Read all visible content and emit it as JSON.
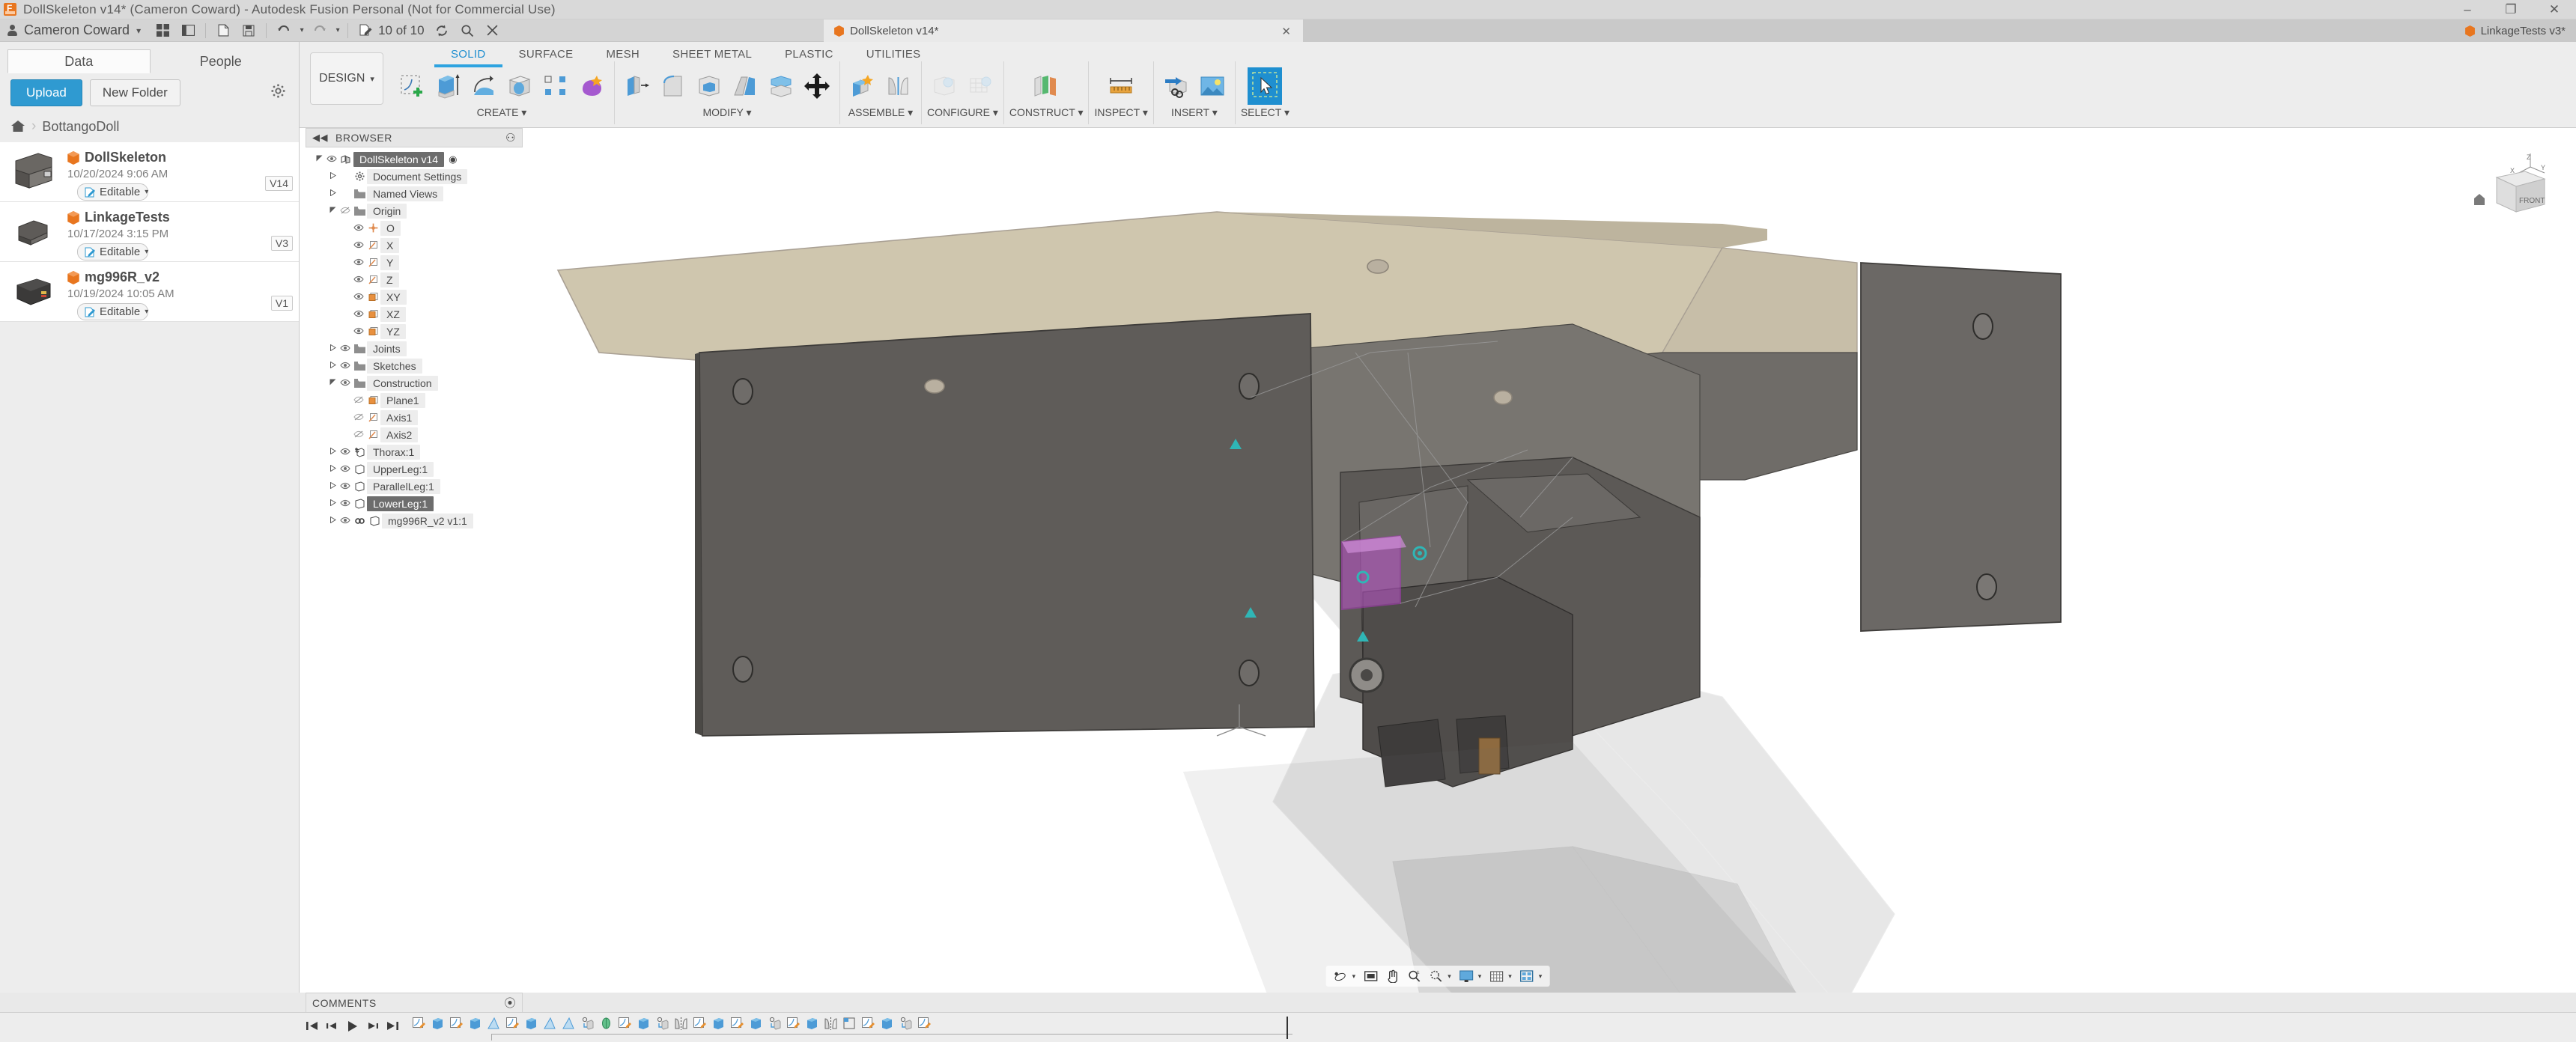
{
  "window": {
    "title": "DollSkeleton v14* (Cameron Coward) - Autodesk Fusion Personal (Not for Commercial Use)",
    "minimize": "–",
    "maximize": "❐",
    "close": "✕",
    "app_icon": "fusion-logo-icon"
  },
  "account": {
    "name": "Cameron Coward",
    "caret": "▾",
    "job_count": "10 of 10",
    "icons": [
      "jobs-icon",
      "refresh-icon",
      "search-icon",
      "close-icon"
    ]
  },
  "quick_access": {
    "icons": [
      "grid-icon",
      "panel-icon",
      "file-icon",
      "save-icon",
      "undo-icon",
      "redo-icon"
    ]
  },
  "doc_tabs": [
    {
      "label": "DollSkeleton v14*",
      "active": true,
      "close": "✕"
    },
    {
      "label": "LinkageTests v3*",
      "active": false,
      "close": ""
    }
  ],
  "data_panel": {
    "tabs": [
      {
        "label": "Data",
        "selected": true
      },
      {
        "label": "People",
        "selected": false
      }
    ],
    "upload_label": "Upload",
    "new_folder_label": "New Folder",
    "settings_icon": "gear-icon",
    "breadcrumb": {
      "home_icon": "home-icon",
      "chevron": "›",
      "text": "BottangoDoll"
    },
    "files": [
      {
        "name": "DollSkeleton",
        "date": "10/20/2024 9:06 AM",
        "permission": "Editable",
        "permission_icon": "editable-pen-icon",
        "version": "V14",
        "thumb": "bracket-thumb"
      },
      {
        "name": "LinkageTests",
        "date": "10/17/2024 3:15 PM",
        "permission": "Editable",
        "permission_icon": "editable-pen-icon",
        "version": "V3",
        "thumb": "linkage-thumb"
      },
      {
        "name": "mg996R_v2",
        "date": "10/19/2024 10:05 AM",
        "permission": "Editable",
        "permission_icon": "editable-pen-icon",
        "version": "V1",
        "thumb": "servo-thumb"
      }
    ]
  },
  "ribbon": {
    "workspace": "DESIGN",
    "workspace_caret": "▾",
    "tabs": [
      {
        "label": "SOLID",
        "selected": true
      },
      {
        "label": "SURFACE",
        "selected": false
      },
      {
        "label": "MESH",
        "selected": false
      },
      {
        "label": "SHEET METAL",
        "selected": false
      },
      {
        "label": "PLASTIC",
        "selected": false
      },
      {
        "label": "UTILITIES",
        "selected": false
      }
    ],
    "panels": [
      {
        "label": "CREATE",
        "caret": "▾",
        "buttons": [
          "new-sketch-icon",
          "extrude-icon",
          "revolve-icon",
          "hole-icon",
          "pattern-icon",
          "form-icon"
        ]
      },
      {
        "label": "MODIFY",
        "caret": "▾",
        "buttons": [
          "press-pull-icon",
          "fillet-icon",
          "shell-icon",
          "draft-icon",
          "split-body-icon",
          "move-copy-icon"
        ]
      },
      {
        "label": "ASSEMBLE",
        "caret": "▾",
        "buttons": [
          "new-component-icon",
          "joint-icon"
        ]
      },
      {
        "label": "CONFIGURE",
        "caret": "▾",
        "buttons": [
          "configure-icon",
          "configure-table-icon"
        ]
      },
      {
        "label": "CONSTRUCT",
        "caret": "▾",
        "buttons": [
          "offset-plane-icon"
        ]
      },
      {
        "label": "INSPECT",
        "caret": "▾",
        "buttons": [
          "measure-icon"
        ]
      },
      {
        "label": "INSERT",
        "caret": "▾",
        "buttons": [
          "insert-derive-icon",
          "decal-icon"
        ]
      },
      {
        "label": "SELECT",
        "caret": "▾",
        "buttons": [
          "select-cursor-icon"
        ]
      }
    ]
  },
  "browser": {
    "title": "BROWSER",
    "collapse_icon": "double-chevron-left-icon",
    "options_icon": "circle-minus-icon",
    "nodes": [
      {
        "label": "DollSkeleton v14",
        "depth": 0,
        "expander": "expanded",
        "eye": "visible",
        "icon": "assembly-icon",
        "selected": true,
        "trailing": "radio-icon"
      },
      {
        "label": "Document Settings",
        "depth": 1,
        "expander": "collapsed",
        "eye": "",
        "icon": "gear-icon",
        "selected": false
      },
      {
        "label": "Named Views",
        "depth": 1,
        "expander": "collapsed",
        "eye": "",
        "icon": "folder-icon",
        "selected": false
      },
      {
        "label": "Origin",
        "depth": 1,
        "expander": "expanded",
        "eye": "hidden",
        "icon": "folder-icon",
        "selected": false
      },
      {
        "label": "O",
        "depth": 2,
        "expander": "",
        "eye": "visible",
        "icon": "origin-point-icon",
        "selected": false
      },
      {
        "label": "X",
        "depth": 2,
        "expander": "",
        "eye": "visible",
        "icon": "axis-icon",
        "selected": false
      },
      {
        "label": "Y",
        "depth": 2,
        "expander": "",
        "eye": "visible",
        "icon": "axis-icon",
        "selected": false
      },
      {
        "label": "Z",
        "depth": 2,
        "expander": "",
        "eye": "visible",
        "icon": "axis-icon",
        "selected": false
      },
      {
        "label": "XY",
        "depth": 2,
        "expander": "",
        "eye": "visible",
        "icon": "plane-icon",
        "selected": false
      },
      {
        "label": "XZ",
        "depth": 2,
        "expander": "",
        "eye": "visible",
        "icon": "plane-icon",
        "selected": false
      },
      {
        "label": "YZ",
        "depth": 2,
        "expander": "",
        "eye": "visible",
        "icon": "plane-icon",
        "selected": false
      },
      {
        "label": "Joints",
        "depth": 1,
        "expander": "collapsed",
        "eye": "visible",
        "icon": "folder-icon",
        "selected": false
      },
      {
        "label": "Sketches",
        "depth": 1,
        "expander": "collapsed",
        "eye": "visible",
        "icon": "folder-icon",
        "selected": false
      },
      {
        "label": "Construction",
        "depth": 1,
        "expander": "expanded",
        "eye": "visible",
        "icon": "folder-icon",
        "selected": false
      },
      {
        "label": "Plane1",
        "depth": 2,
        "expander": "",
        "eye": "hidden",
        "icon": "plane-icon",
        "selected": false
      },
      {
        "label": "Axis1",
        "depth": 2,
        "expander": "",
        "eye": "hidden",
        "icon": "axis-icon",
        "selected": false
      },
      {
        "label": "Axis2",
        "depth": 2,
        "expander": "",
        "eye": "hidden",
        "icon": "axis-icon",
        "selected": false
      },
      {
        "label": "Thorax:1",
        "depth": 1,
        "expander": "collapsed",
        "eye": "visible",
        "icon": "grounded-component-icon",
        "selected": false
      },
      {
        "label": "UpperLeg:1",
        "depth": 1,
        "expander": "collapsed",
        "eye": "visible",
        "icon": "component-icon",
        "selected": false
      },
      {
        "label": "ParallelLeg:1",
        "depth": 1,
        "expander": "collapsed",
        "eye": "visible",
        "icon": "component-icon",
        "selected": false
      },
      {
        "label": "LowerLeg:1",
        "depth": 1,
        "expander": "collapsed",
        "eye": "visible",
        "icon": "component-icon",
        "selected": true
      },
      {
        "label": "mg996R_v2 v1:1",
        "depth": 1,
        "expander": "collapsed",
        "eye": "visible",
        "icon": "component-icon",
        "selected": false,
        "link": "link-icon"
      }
    ]
  },
  "viewcube": {
    "label": "FRONT",
    "axis_z": "Z",
    "axis_y": "Y",
    "axis_x": "X",
    "home_icon": "home-icon"
  },
  "navbar": {
    "buttons": [
      {
        "icon": "orbit-icon",
        "caret": "▾"
      },
      {
        "icon": "fit-icon",
        "caret": ""
      },
      {
        "icon": "pan-icon",
        "caret": ""
      },
      {
        "icon": "zoom-icon",
        "caret": ""
      },
      {
        "icon": "zoom-window-icon",
        "caret": "▾"
      },
      {
        "icon": "display-settings-icon",
        "caret": "▾"
      },
      {
        "icon": "grid-snap-icon",
        "caret": "▾"
      },
      {
        "icon": "viewports-icon",
        "caret": "▾"
      }
    ]
  },
  "comments": {
    "title": "COMMENTS",
    "add_icon": "circle-plus-icon"
  },
  "timeline": {
    "controls": [
      "go-to-beginning-icon",
      "step-back-icon",
      "play-icon",
      "step-forward-icon",
      "go-to-end-icon"
    ],
    "features": [
      "sketch-icon",
      "extrude-icon",
      "sketch-icon",
      "extrude-icon",
      "draft-icon",
      "sketch-icon",
      "extrude-icon",
      "draft-icon",
      "draft-icon",
      "hole-icon",
      "revolve-icon",
      "sketch-icon",
      "extrude-icon",
      "hole-icon",
      "mirror-icon",
      "sketch-icon",
      "extrude-icon",
      "sketch-icon",
      "extrude-icon",
      "hole-icon",
      "sketch-icon",
      "extrude-icon",
      "mirror-icon",
      "rectangular-pattern-icon",
      "sketch-icon",
      "extrude-icon",
      "hole-icon",
      "sketch-icon"
    ],
    "marker_position": "28"
  }
}
